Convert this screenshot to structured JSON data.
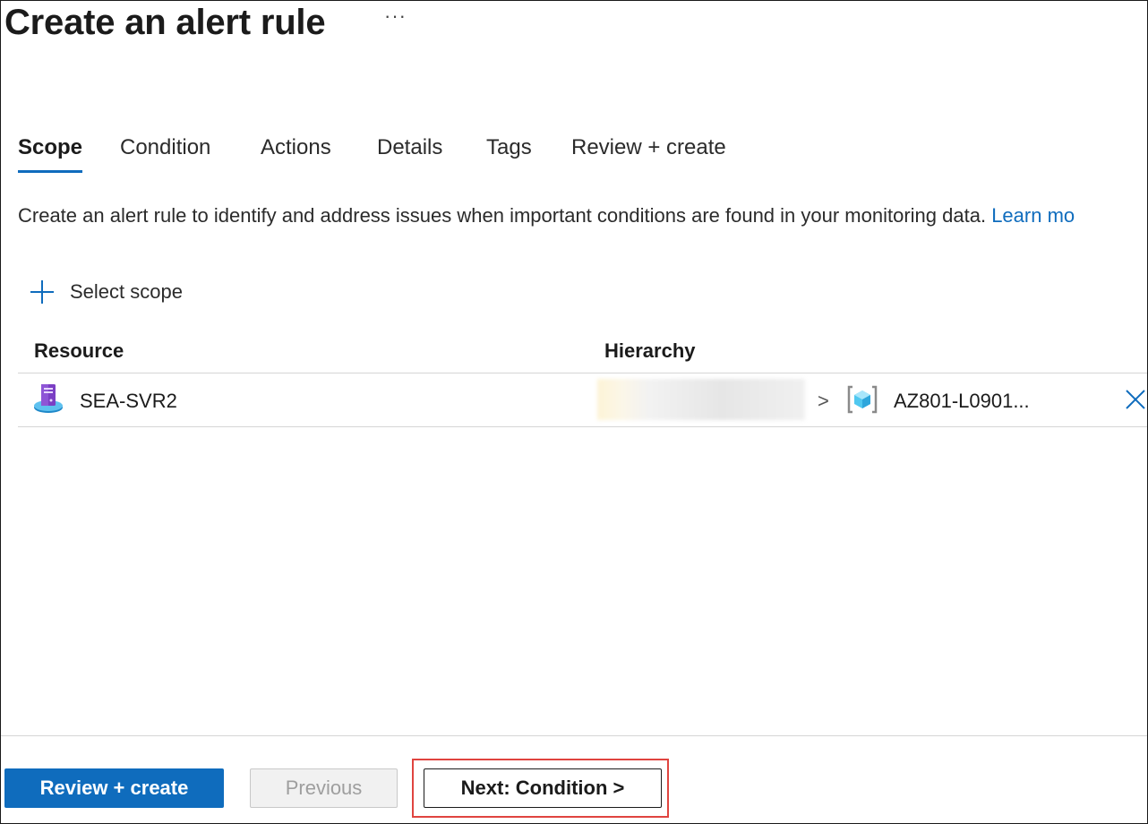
{
  "page": {
    "title": "Create an alert rule",
    "more_label": "···"
  },
  "tabs": [
    {
      "label": "Scope",
      "active": true
    },
    {
      "label": "Condition",
      "active": false
    },
    {
      "label": "Actions",
      "active": false
    },
    {
      "label": "Details",
      "active": false
    },
    {
      "label": "Tags",
      "active": false
    },
    {
      "label": "Review + create",
      "active": false
    }
  ],
  "description": {
    "text": "Create an alert rule to identify and address issues when important conditions are found in your monitoring data.",
    "link": "Learn mo"
  },
  "scope": {
    "select_label": "Select scope",
    "columns": {
      "resource": "Resource",
      "hierarchy": "Hierarchy"
    },
    "rows": [
      {
        "resource": "SEA-SVR2",
        "hierarchy_last": "AZ801-L0901...",
        "hierarchy_separator": ">"
      }
    ]
  },
  "footer": {
    "review_create": "Review + create",
    "previous": "Previous",
    "next": "Next: Condition >"
  },
  "colors": {
    "accent": "#0f6cbd",
    "highlight": "#e0443f"
  },
  "icons": {
    "add": "plus-icon",
    "resource": "server-icon",
    "hierarchy": "resource-group-icon",
    "remove": "close-icon",
    "chevron": "chevron-right-icon"
  }
}
